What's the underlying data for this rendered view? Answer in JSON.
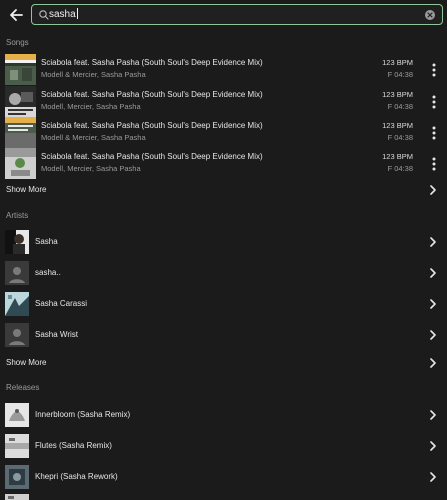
{
  "search": {
    "value": "sasha"
  },
  "sections": {
    "songs": "Songs",
    "artists": "Artists",
    "releases": "Releases"
  },
  "songs": [
    {
      "title": "Sciabola feat. Sasha Pasha (South Soul's Deep Evidence Mix)",
      "artists": "Modell & Mercier, Sasha Pasha",
      "bpm": "123 BPM",
      "key_duration": "F  04:38"
    },
    {
      "title": "Sciabola feat. Sasha Pasha (South Soul's Deep Evidence Mix)",
      "artists": "Modell, Mercier, Sasha Pasha",
      "bpm": "123 BPM",
      "key_duration": "F  04:38"
    },
    {
      "title": "Sciabola feat. Sasha Pasha (South Soul's Deep Evidence Mix)",
      "artists": "Modell & Mercier, Sasha Pasha",
      "bpm": "123 BPM",
      "key_duration": "F  04:38"
    },
    {
      "title": "Sciabola feat. Sasha Pasha (South Soul's Deep Evidence Mix)",
      "artists": "Modell, Mercier, Sasha Pasha",
      "bpm": "123 BPM",
      "key_duration": "F  04:38"
    }
  ],
  "show_more": "Show More",
  "artists": [
    {
      "name": "Sasha"
    },
    {
      "name": "sasha.."
    },
    {
      "name": "Sasha Carassi"
    },
    {
      "name": "Sasha Wrist"
    }
  ],
  "releases": [
    {
      "name": "Innerbloom (Sasha Remix)"
    },
    {
      "name": "Flutes (Sasha Remix)"
    },
    {
      "name": "Khepri (Sasha Rework)"
    }
  ],
  "colors": {
    "accent": "#8fc79a",
    "background": "#1b1b1b"
  }
}
